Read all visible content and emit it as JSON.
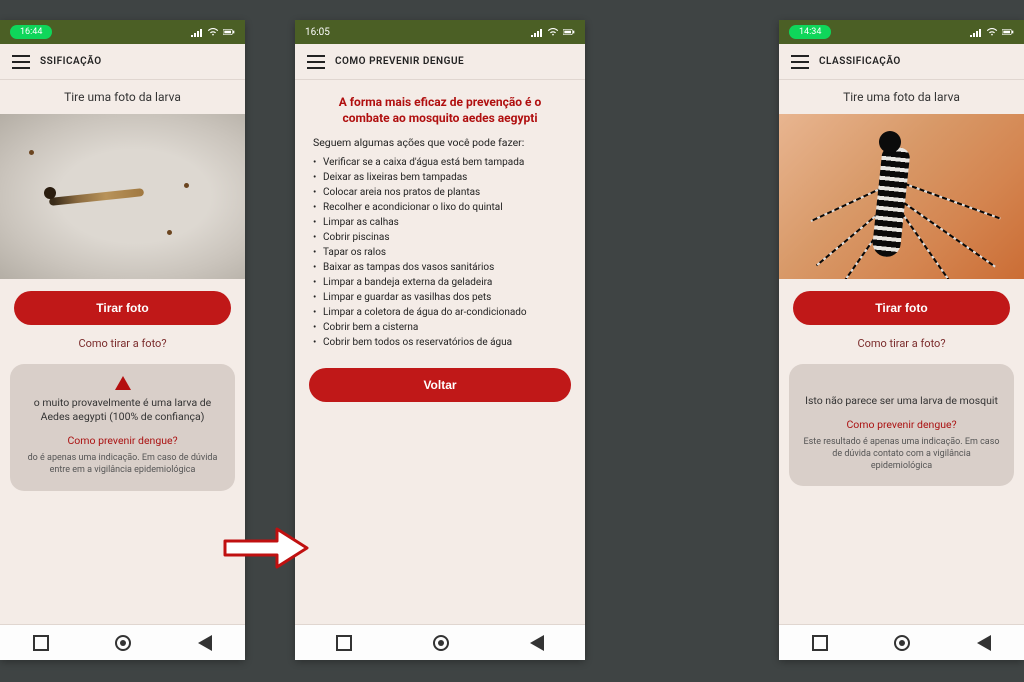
{
  "phone1": {
    "status": {
      "time": "16:44"
    },
    "header": {
      "title": "SSIFICAÇÃO"
    },
    "instruction": "Tire uma foto da larva",
    "buttons": {
      "take_photo": "Tirar foto"
    },
    "links": {
      "how_to": "Como tirar a foto?"
    },
    "result": {
      "text": "o muito provavelmente é uma larva de Aedes aegypti (100% de confiança)",
      "link": "Como prevenir dengue?",
      "disclaimer": "do é apenas uma indicação. Em caso de dúvida entre em a vigilância epidemiológica"
    }
  },
  "phone2": {
    "status": {
      "time": "16:05"
    },
    "header": {
      "title": "COMO PREVENIR DENGUE"
    },
    "title": "A forma mais eficaz de prevenção é o combate ao mosquito aedes aegypti",
    "intro": "Seguem algumas ações que você pode fazer:",
    "tips": [
      "Verificar se a caixa d'água está bem tampada",
      "Deixar as lixeiras bem tampadas",
      "Colocar areia nos pratos de plantas",
      "Recolher e acondicionar o lixo do quintal",
      "Limpar as calhas",
      "Cobrir piscinas",
      "Tapar os ralos",
      "Baixar as tampas dos vasos sanitários",
      "Limpar a bandeja externa da geladeira",
      "Limpar e guardar as vasilhas dos pets",
      "Limpar a coletora de água do ar-condicionado",
      "Cobrir bem a cisterna",
      "Cobrir bem todos os reservatórios de água"
    ],
    "buttons": {
      "back": "Voltar"
    }
  },
  "phone3": {
    "status": {
      "time": "14:34"
    },
    "header": {
      "title": "CLASSIFICAÇÃO"
    },
    "instruction": "Tire uma foto da larva",
    "buttons": {
      "take_photo": "Tirar foto"
    },
    "links": {
      "how_to": "Como tirar a foto?"
    },
    "result": {
      "text": "Isto não parece ser uma larva de mosquit",
      "link": "Como prevenir dengue?",
      "disclaimer": "Este resultado é apenas uma indicação. Em caso de dúvida contato com a vigilância epidemiológica"
    }
  }
}
